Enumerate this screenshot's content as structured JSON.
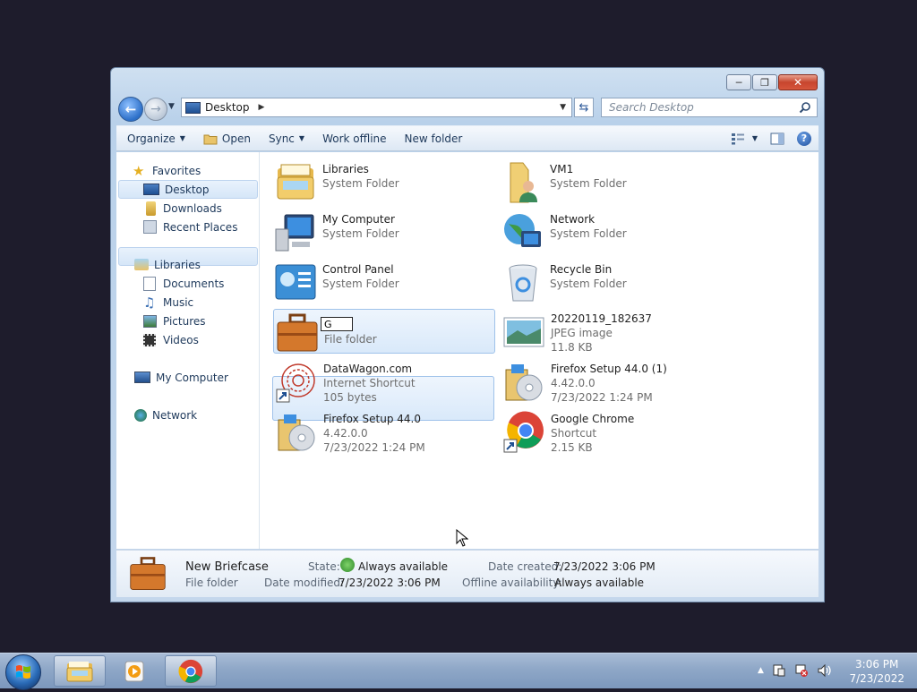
{
  "window": {
    "address_crumb": "Desktop",
    "search_placeholder": "Search Desktop"
  },
  "toolbar": {
    "organize": "Organize",
    "open": "Open",
    "sync": "Sync",
    "work_offline": "Work offline",
    "new_folder": "New folder"
  },
  "nav": {
    "favorites": "Favorites",
    "desktop": "Desktop",
    "downloads": "Downloads",
    "recent_places": "Recent Places",
    "libraries": "Libraries",
    "documents": "Documents",
    "music": "Music",
    "pictures": "Pictures",
    "videos": "Videos",
    "my_computer": "My Computer",
    "network": "Network"
  },
  "items": [
    {
      "name": "Libraries",
      "type": "System Folder"
    },
    {
      "name": "VM1",
      "type": "System Folder"
    },
    {
      "name": "My Computer",
      "type": "System Folder"
    },
    {
      "name": "Network",
      "type": "System Folder"
    },
    {
      "name": "Control Panel",
      "type": "System Folder"
    },
    {
      "name": "Recycle Bin",
      "type": "System Folder"
    },
    {
      "name": "G",
      "type": "File folder"
    },
    {
      "name": "20220119_182637",
      "type": "JPEG image",
      "size": "11.8 KB"
    },
    {
      "name": "DataWagon.com",
      "type": "Internet Shortcut",
      "size": "105 bytes"
    },
    {
      "name": "Firefox Setup 44.0 (1)",
      "type": "4.42.0.0",
      "size": "7/23/2022 1:24 PM"
    },
    {
      "name": "Firefox Setup 44.0",
      "type": "4.42.0.0",
      "size": "7/23/2022 1:24 PM"
    },
    {
      "name": "Google Chrome",
      "type": "Shortcut",
      "size": "2.15 KB"
    }
  ],
  "details": {
    "name": "New Briefcase",
    "type": "File folder",
    "state_label": "State:",
    "state_value": "Always available",
    "modified_label": "Date modified:",
    "modified_value": "7/23/2022 3:06 PM",
    "created_label": "Date created:",
    "created_value": "7/23/2022 3:06 PM",
    "offline_label": "Offline availability:",
    "offline_value": "Always available"
  },
  "taskbar": {
    "time": "3:06 PM",
    "date": "7/23/2022"
  }
}
